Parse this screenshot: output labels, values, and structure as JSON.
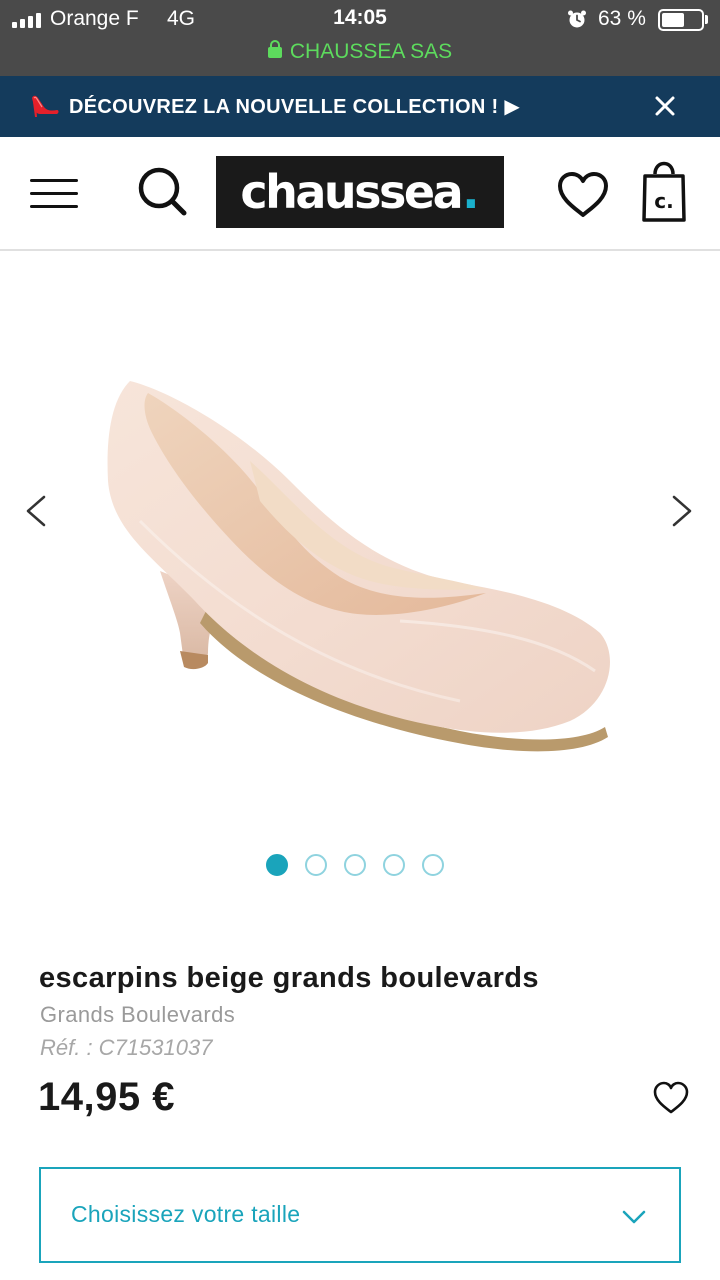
{
  "status_bar": {
    "carrier": "Orange F",
    "network": "4G",
    "time": "14:05",
    "battery_percent_label": "63 %",
    "battery_level": 0.63,
    "site_name": "CHAUSSEA SAS",
    "site_color": "#5ddb5d"
  },
  "promo": {
    "text": "DÉCOUVREZ LA NOUVELLE COLLECTION ! ▶",
    "icon": "high-heel-icon",
    "background": "#143b5c"
  },
  "header": {
    "menu_icon": "hamburger-menu-icon",
    "search_icon": "search-icon",
    "logo_text": "chaussea",
    "logo_dot": ".",
    "wishlist_icon": "heart-icon",
    "bag_icon": "shopping-bag-icon",
    "bag_letter": "c.",
    "accent": "#1ab0cc"
  },
  "gallery": {
    "image_count": 5,
    "active_index": 0,
    "prev_icon": "chevron-left-icon",
    "next_icon": "chevron-right-icon"
  },
  "product": {
    "title": "escarpins beige grands boulevards",
    "brand": "Grands Boulevards",
    "reference": "Réf. : C71531037",
    "price": "14,95 €",
    "wishlist_icon": "heart-icon"
  },
  "size_selector": {
    "label": "Choisissez votre taille",
    "icon": "chevron-down-icon",
    "accent": "#1aa4bb"
  }
}
